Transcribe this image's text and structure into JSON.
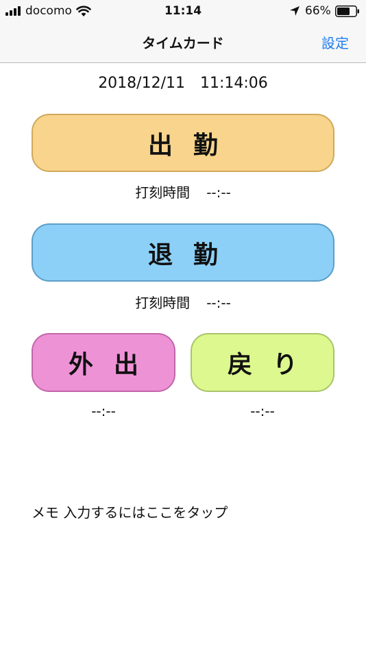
{
  "status_bar": {
    "carrier": "docomo",
    "time": "11:14",
    "battery": "66%"
  },
  "nav": {
    "title": "タイムカード",
    "settings_label": "設定"
  },
  "datetime": "2018/12/11　11:14:06",
  "buttons": {
    "clock_in": "出勤",
    "clock_out": "退勤",
    "go_out": "外出",
    "return": "戻り"
  },
  "stamp_label": "打刻時間",
  "clock_in_time": "--:--",
  "clock_out_time": "--:--",
  "go_out_time": "--:--",
  "return_time": "--:--",
  "memo_placeholder": "メモ  入力するにはここをタップ",
  "colors": {
    "accent": "#1f7cf4",
    "clock_in": "#f8d48c",
    "clock_out": "#8cd0f8",
    "go_out": "#ee92d6",
    "return": "#dcf88e"
  }
}
